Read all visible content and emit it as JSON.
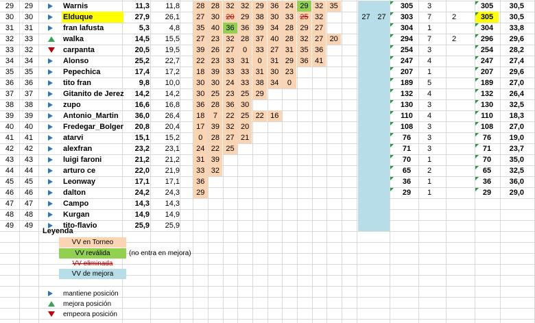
{
  "colors": {
    "peach": "#fbd4b4",
    "green": "#92d050",
    "blue": "#b7dde8",
    "highlight": "#ffff00",
    "strike": "#c00000",
    "arrow_keep": "#2e75b6",
    "arrow_up": "#3aa35a",
    "arrow_down": "#c00000"
  },
  "rows": [
    {
      "a": "29",
      "b": "29",
      "trend": "same",
      "name": "Warnis",
      "c1": "11,3",
      "c2": "11,8",
      "vv": [
        "28",
        "28",
        "32",
        "32",
        "29",
        "36",
        "24",
        "29",
        "32",
        "35"
      ],
      "vv_green": [
        7
      ],
      "vv_strike": [],
      "m1": "",
      "m2": "",
      "s": "305",
      "n": "3",
      "x": "",
      "s2": "305",
      "avg": "30,5"
    },
    {
      "a": "30",
      "b": "30",
      "trend": "same",
      "name": "Elduque",
      "c1": "27,9",
      "c2": "26,1",
      "vv": [
        "27",
        "30",
        "20",
        "29",
        "38",
        "30",
        "33",
        "25",
        "32"
      ],
      "vv_green": [],
      "vv_strike": [
        2,
        7
      ],
      "m1": "27",
      "m2": "27",
      "s": "303",
      "n": "7",
      "x": "2",
      "s2": "305",
      "avg": "30,5",
      "highlight": true
    },
    {
      "a": "31",
      "b": "31",
      "trend": "same",
      "name": "fran lafusta",
      "c1": "5,3",
      "c2": "4,8",
      "vv": [
        "35",
        "40",
        "36",
        "36",
        "39",
        "34",
        "28",
        "29",
        "27"
      ],
      "vv_green": [
        2
      ],
      "vv_strike": [],
      "m1": "",
      "m2": "",
      "s": "304",
      "n": "1",
      "x": "",
      "s2": "304",
      "avg": "33,8"
    },
    {
      "a": "32",
      "b": "33",
      "trend": "up",
      "name": "walka",
      "c1": "14,5",
      "c2": "15,5",
      "vv": [
        "27",
        "23",
        "32",
        "28",
        "37",
        "40",
        "28",
        "32",
        "27",
        "20"
      ],
      "vv_green": [],
      "vv_strike": [],
      "m1": "",
      "m2": "",
      "s": "294",
      "n": "7",
      "x": "2",
      "s2": "296",
      "avg": "29,6"
    },
    {
      "a": "33",
      "b": "32",
      "trend": "down",
      "name": "carpanta",
      "c1": "20,5",
      "c2": "19,5",
      "vv": [
        "39",
        "26",
        "27",
        "0",
        "33",
        "27",
        "31",
        "35",
        "36"
      ],
      "vv_green": [],
      "vv_strike": [],
      "m1": "",
      "m2": "",
      "s": "254",
      "n": "3",
      "x": "",
      "s2": "254",
      "avg": "28,2"
    },
    {
      "a": "34",
      "b": "34",
      "trend": "same",
      "name": "Alonso",
      "c1": "25,2",
      "c2": "22,7",
      "vv": [
        "22",
        "23",
        "33",
        "31",
        "0",
        "31",
        "29",
        "36",
        "41"
      ],
      "vv_green": [],
      "vv_strike": [],
      "m1": "",
      "m2": "",
      "s": "247",
      "n": "4",
      "x": "",
      "s2": "247",
      "avg": "27,4"
    },
    {
      "a": "35",
      "b": "35",
      "trend": "same",
      "name": "Pepechica",
      "c1": "17,4",
      "c2": "17,2",
      "vv": [
        "18",
        "39",
        "33",
        "33",
        "31",
        "30",
        "23"
      ],
      "vv_green": [],
      "vv_strike": [],
      "m1": "",
      "m2": "",
      "s": "207",
      "n": "1",
      "x": "",
      "s2": "207",
      "avg": "29,6"
    },
    {
      "a": "36",
      "b": "36",
      "trend": "same",
      "name": "tito fran",
      "c1": "9,8",
      "c2": "10,0",
      "vv": [
        "30",
        "30",
        "24",
        "33",
        "38",
        "34",
        "0"
      ],
      "vv_green": [],
      "vv_strike": [],
      "m1": "",
      "m2": "",
      "s": "189",
      "n": "5",
      "x": "",
      "s2": "189",
      "avg": "27,0"
    },
    {
      "a": "37",
      "b": "37",
      "trend": "same",
      "name": "Gitanito de Jerez",
      "c1": "14,2",
      "c2": "14,2",
      "vv": [
        "30",
        "25",
        "23",
        "25",
        "29"
      ],
      "vv_green": [],
      "vv_strike": [],
      "m1": "",
      "m2": "",
      "s": "132",
      "n": "4",
      "x": "",
      "s2": "132",
      "avg": "26,4"
    },
    {
      "a": "38",
      "b": "38",
      "trend": "same",
      "name": "zupo",
      "c1": "16,6",
      "c2": "16,8",
      "vv": [
        "36",
        "28",
        "36",
        "30"
      ],
      "vv_green": [],
      "vv_strike": [],
      "m1": "",
      "m2": "",
      "s": "130",
      "n": "3",
      "x": "",
      "s2": "130",
      "avg": "32,5"
    },
    {
      "a": "39",
      "b": "39",
      "trend": "same",
      "name": "Antonio_Martin",
      "c1": "36,0",
      "c2": "26,4",
      "vv": [
        "18",
        "7",
        "22",
        "25",
        "22",
        "16"
      ],
      "vv_green": [],
      "vv_strike": [],
      "m1": "",
      "m2": "",
      "s": "110",
      "n": "4",
      "x": "",
      "s2": "110",
      "avg": "18,3"
    },
    {
      "a": "40",
      "b": "40",
      "trend": "same",
      "name": "Fredegar_Bolger",
      "c1": "20,8",
      "c2": "20,4",
      "vv": [
        "17",
        "39",
        "32",
        "20"
      ],
      "vv_green": [],
      "vv_strike": [],
      "m1": "",
      "m2": "",
      "s": "108",
      "n": "3",
      "x": "",
      "s2": "108",
      "avg": "27,0"
    },
    {
      "a": "41",
      "b": "41",
      "trend": "same",
      "name": "atarvi",
      "c1": "15,1",
      "c2": "15,2",
      "vv": [
        "0",
        "28",
        "27",
        "21"
      ],
      "vv_green": [],
      "vv_strike": [],
      "m1": "",
      "m2": "",
      "s": "76",
      "n": "3",
      "x": "",
      "s2": "76",
      "avg": "19,0"
    },
    {
      "a": "42",
      "b": "42",
      "trend": "same",
      "name": "alexfran",
      "c1": "23,2",
      "c2": "23,1",
      "vv": [
        "24",
        "22",
        "25"
      ],
      "vv_green": [],
      "vv_strike": [],
      "m1": "",
      "m2": "",
      "s": "71",
      "n": "3",
      "x": "",
      "s2": "71",
      "avg": "23,7"
    },
    {
      "a": "43",
      "b": "43",
      "trend": "same",
      "name": "luigi faroni",
      "c1": "21,2",
      "c2": "21,2",
      "vv": [
        "31",
        "39"
      ],
      "vv_green": [],
      "vv_strike": [],
      "m1": "",
      "m2": "",
      "s": "70",
      "n": "1",
      "x": "",
      "s2": "70",
      "avg": "35,0"
    },
    {
      "a": "44",
      "b": "44",
      "trend": "same",
      "name": "arturo ce",
      "c1": "22,0",
      "c2": "21,9",
      "vv": [
        "33",
        "32"
      ],
      "vv_green": [],
      "vv_strike": [],
      "m1": "",
      "m2": "",
      "s": "65",
      "n": "2",
      "x": "",
      "s2": "65",
      "avg": "32,5"
    },
    {
      "a": "45",
      "b": "45",
      "trend": "same",
      "name": "Leonway",
      "c1": "17,1",
      "c2": "17,1",
      "vv": [
        "36"
      ],
      "vv_green": [],
      "vv_strike": [],
      "m1": "",
      "m2": "",
      "s": "36",
      "n": "1",
      "x": "",
      "s2": "36",
      "avg": "36,0"
    },
    {
      "a": "46",
      "b": "46",
      "trend": "same",
      "name": "dalton",
      "c1": "24,2",
      "c2": "24,3",
      "vv": [
        "29"
      ],
      "vv_green": [],
      "vv_strike": [],
      "m1": "",
      "m2": "",
      "s": "29",
      "n": "1",
      "x": "",
      "s2": "29",
      "avg": "29,0"
    },
    {
      "a": "47",
      "b": "47",
      "trend": "same",
      "name": "Campo",
      "c1": "14,3",
      "c2": "14,3",
      "vv": [],
      "vv_green": [],
      "vv_strike": [],
      "m1": "",
      "m2": "",
      "s": "",
      "n": "",
      "x": "",
      "s2": "",
      "avg": ""
    },
    {
      "a": "48",
      "b": "48",
      "trend": "same",
      "name": "Kurgan",
      "c1": "14,9",
      "c2": "14,9",
      "vv": [],
      "vv_green": [],
      "vv_strike": [],
      "m1": "",
      "m2": "",
      "s": "",
      "n": "",
      "x": "",
      "s2": "",
      "avg": ""
    },
    {
      "a": "49",
      "b": "49",
      "trend": "same",
      "name": "tito-flavio",
      "c1": "25,9",
      "c2": "25,9",
      "vv": [],
      "vv_green": [],
      "vv_strike": [],
      "m1": "",
      "m2": "",
      "s": "",
      "n": "",
      "x": "",
      "s2": "",
      "avg": ""
    }
  ],
  "legend": {
    "title": "Leyenda",
    "torneo": "VV en Torneo",
    "revalida": "VV reválida",
    "revalida_note": "(no entra en mejora)",
    "eliminada": "VV eliminada",
    "mejora": "VV de mejora",
    "mantiene": "mantiene posición",
    "mejora_pos": "mejora posición",
    "empeora": "empeora posición"
  }
}
